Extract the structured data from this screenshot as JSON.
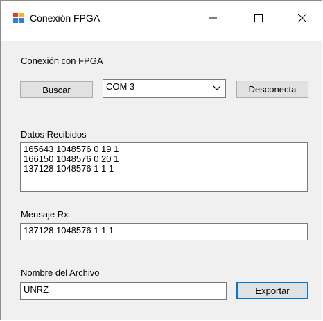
{
  "window": {
    "title": "Conexión FPGA",
    "minimize_glyph": "—",
    "maximize_glyph": "☐",
    "close_glyph": "✕"
  },
  "connection": {
    "section_label": "Conexión con FPGA",
    "search_button": "Buscar",
    "port_value": "COM 3",
    "disconnect_button": "Desconecta"
  },
  "received": {
    "label": "Datos Recibidos",
    "lines": [
      "165643 1048576 0 19 1",
      "166150 1048576 0 20 1",
      "137128 1048576 1 1 1"
    ]
  },
  "rx": {
    "label": "Mensaje Rx",
    "value": "137128 1048576 1 1 1"
  },
  "file": {
    "label": "Nombre del Archivo",
    "value": "UNRZ",
    "export_button": "Exportar"
  },
  "icons": {
    "app": "app-icon",
    "minimize": "minimize-icon",
    "maximize": "maximize-icon",
    "close": "close-icon",
    "dropdown": "chevron-down-icon"
  }
}
